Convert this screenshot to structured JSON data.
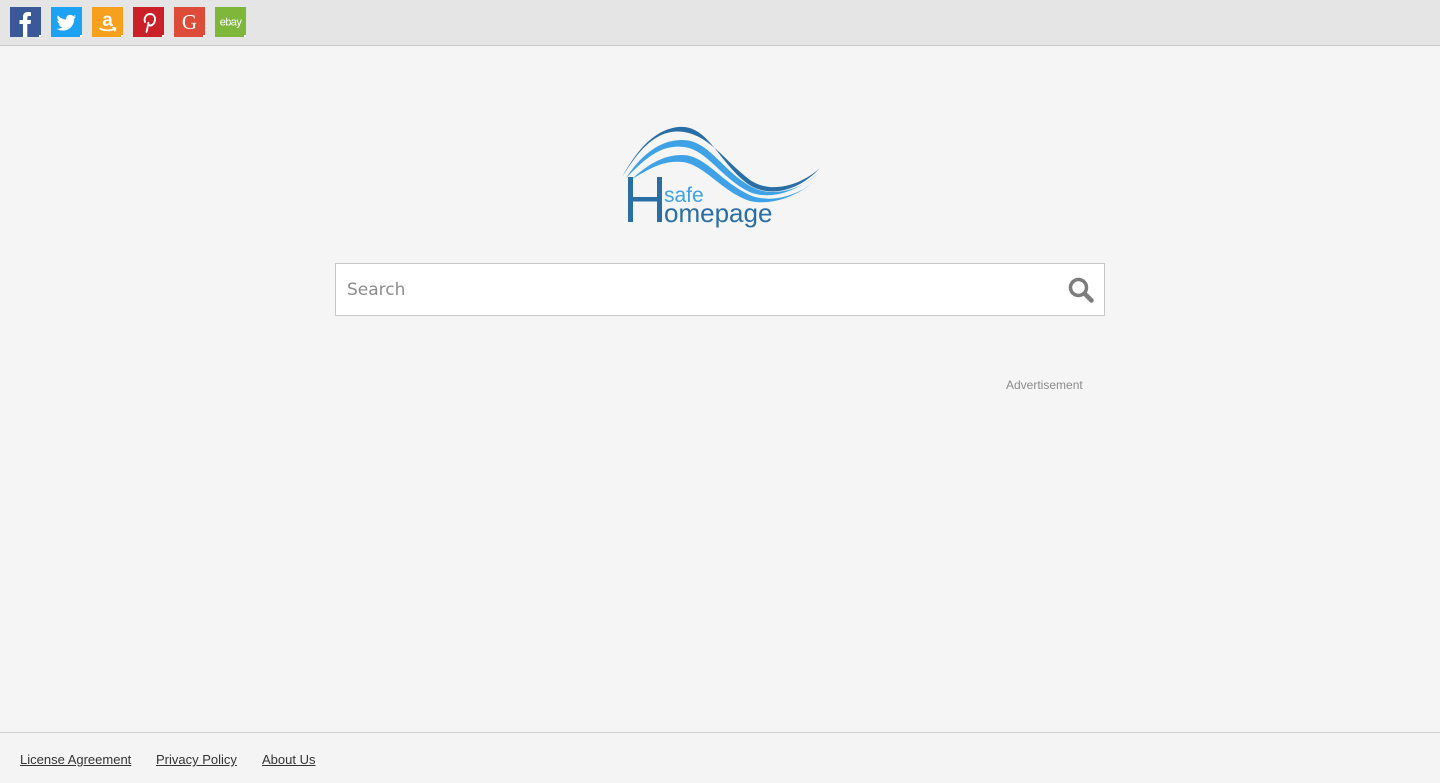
{
  "shortcuts": [
    {
      "name": "facebook",
      "label": "f",
      "color": "#3b5998"
    },
    {
      "name": "twitter",
      "label": "twitter-bird",
      "color": "#1da1f2"
    },
    {
      "name": "amazon",
      "label": "a",
      "color": "#f7a01e"
    },
    {
      "name": "pinterest",
      "label": "P",
      "color": "#cb2027"
    },
    {
      "name": "google",
      "label": "G",
      "color": "#dd4b39"
    },
    {
      "name": "ebay",
      "label": "ebay",
      "color": "#7fb73a"
    }
  ],
  "logo": {
    "line1": "safe",
    "line2": "omepage",
    "initial": "H",
    "colors": {
      "dark_blue": "#2a6ea6",
      "light_blue": "#3fa2e6"
    }
  },
  "search": {
    "placeholder": "Search",
    "value": ""
  },
  "ad": {
    "label": "Advertisement"
  },
  "footer": {
    "links": [
      "License Agreement",
      "Privacy Policy",
      "About Us"
    ]
  }
}
